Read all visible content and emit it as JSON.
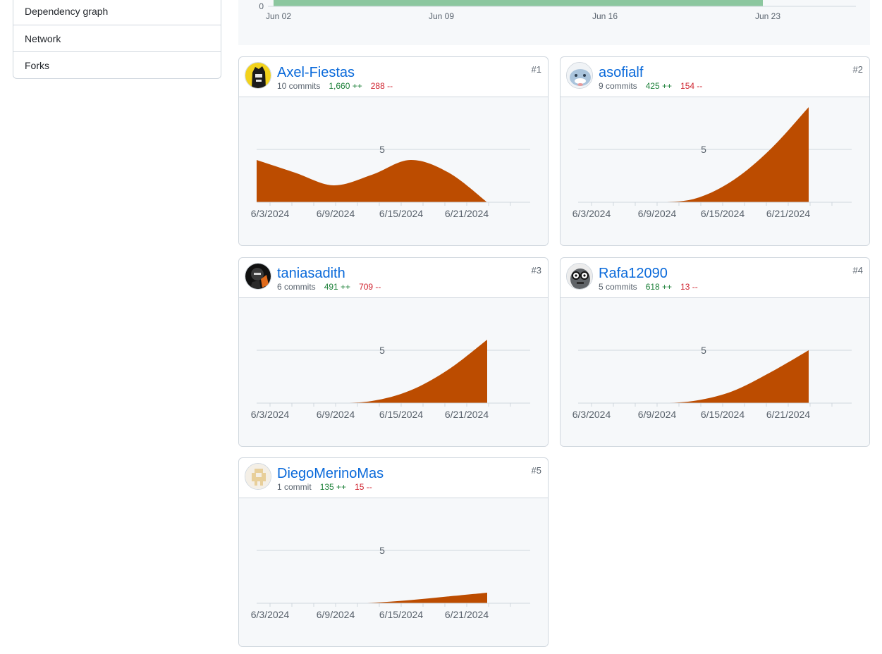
{
  "sidebar": {
    "items": [
      {
        "label": "Dependency graph"
      },
      {
        "label": "Network"
      },
      {
        "label": "Forks"
      }
    ]
  },
  "overview": {
    "y_tick": "0",
    "x_ticks": [
      "Jun 02",
      "Jun 09",
      "Jun 16",
      "Jun 23"
    ],
    "bar_color": "#8cc79f"
  },
  "contributors": [
    {
      "rank": "#1",
      "name": "Axel-Fiestas",
      "commits": "10 commits",
      "additions": "1,660 ++",
      "deletions": "288 --",
      "avatar": "axel-avatar"
    },
    {
      "rank": "#2",
      "name": "asofialf",
      "commits": "9 commits",
      "additions": "425 ++",
      "deletions": "154 --",
      "avatar": "asofialf-avatar"
    },
    {
      "rank": "#3",
      "name": "taniasadith",
      "commits": "6 commits",
      "additions": "491 ++",
      "deletions": "709 --",
      "avatar": "taniasadith-avatar"
    },
    {
      "rank": "#4",
      "name": "Rafa12090",
      "commits": "5 commits",
      "additions": "618 ++",
      "deletions": "13 --",
      "avatar": "rafa-avatar"
    },
    {
      "rank": "#5",
      "name": "DiegoMerinoMas",
      "commits": "1 commit",
      "additions": "135 ++",
      "deletions": "15 --",
      "avatar": "diego-avatar"
    }
  ],
  "chart_data": [
    {
      "type": "area",
      "x": [
        "6/3/2024",
        "6/6/2024",
        "6/9/2024",
        "6/12/2024",
        "6/15/2024",
        "6/18/2024",
        "6/21/2024"
      ],
      "x_ticks": [
        "6/3/2024",
        "6/9/2024",
        "6/15/2024",
        "6/21/2024"
      ],
      "y_ticks": [
        5
      ],
      "ylim": [
        0,
        10
      ],
      "color": "#bc4c00",
      "series": [
        {
          "name": "Axel-Fiestas",
          "values": [
            4,
            2.8,
            1.6,
            2.6,
            4,
            2.8,
            0
          ]
        }
      ]
    },
    {
      "type": "area",
      "x": [
        "6/3/2024",
        "6/6/2024",
        "6/9/2024",
        "6/12/2024",
        "6/15/2024",
        "6/18/2024",
        "6/21/2024"
      ],
      "x_ticks": [
        "6/3/2024",
        "6/9/2024",
        "6/15/2024",
        "6/21/2024"
      ],
      "y_ticks": [
        5
      ],
      "ylim": [
        0,
        10
      ],
      "color": "#bc4c00",
      "series": [
        {
          "name": "asofialf",
          "values": [
            0,
            0,
            0,
            0.3,
            2,
            5,
            9
          ]
        }
      ]
    },
    {
      "type": "area",
      "x": [
        "6/3/2024",
        "6/6/2024",
        "6/9/2024",
        "6/12/2024",
        "6/15/2024",
        "6/18/2024",
        "6/21/2024"
      ],
      "x_ticks": [
        "6/3/2024",
        "6/9/2024",
        "6/15/2024",
        "6/21/2024"
      ],
      "y_ticks": [
        5
      ],
      "ylim": [
        0,
        10
      ],
      "color": "#bc4c00",
      "series": [
        {
          "name": "taniasadith",
          "values": [
            0,
            0,
            0,
            0.2,
            1.2,
            3.2,
            6
          ]
        }
      ]
    },
    {
      "type": "area",
      "x": [
        "6/3/2024",
        "6/6/2024",
        "6/9/2024",
        "6/12/2024",
        "6/15/2024",
        "6/18/2024",
        "6/21/2024"
      ],
      "x_ticks": [
        "6/3/2024",
        "6/9/2024",
        "6/15/2024",
        "6/21/2024"
      ],
      "y_ticks": [
        5
      ],
      "ylim": [
        0,
        10
      ],
      "color": "#bc4c00",
      "series": [
        {
          "name": "Rafa12090",
          "values": [
            0,
            0,
            0,
            0.2,
            1.1,
            2.9,
            5
          ]
        }
      ]
    },
    {
      "type": "area",
      "x": [
        "6/3/2024",
        "6/6/2024",
        "6/9/2024",
        "6/12/2024",
        "6/15/2024",
        "6/18/2024",
        "6/21/2024"
      ],
      "x_ticks": [
        "6/3/2024",
        "6/9/2024",
        "6/15/2024",
        "6/21/2024"
      ],
      "y_ticks": [
        5
      ],
      "ylim": [
        0,
        10
      ],
      "color": "#bc4c00",
      "series": [
        {
          "name": "DiegoMerinoMas",
          "values": [
            0,
            0,
            0,
            0.05,
            0.3,
            0.65,
            1
          ]
        }
      ]
    }
  ]
}
